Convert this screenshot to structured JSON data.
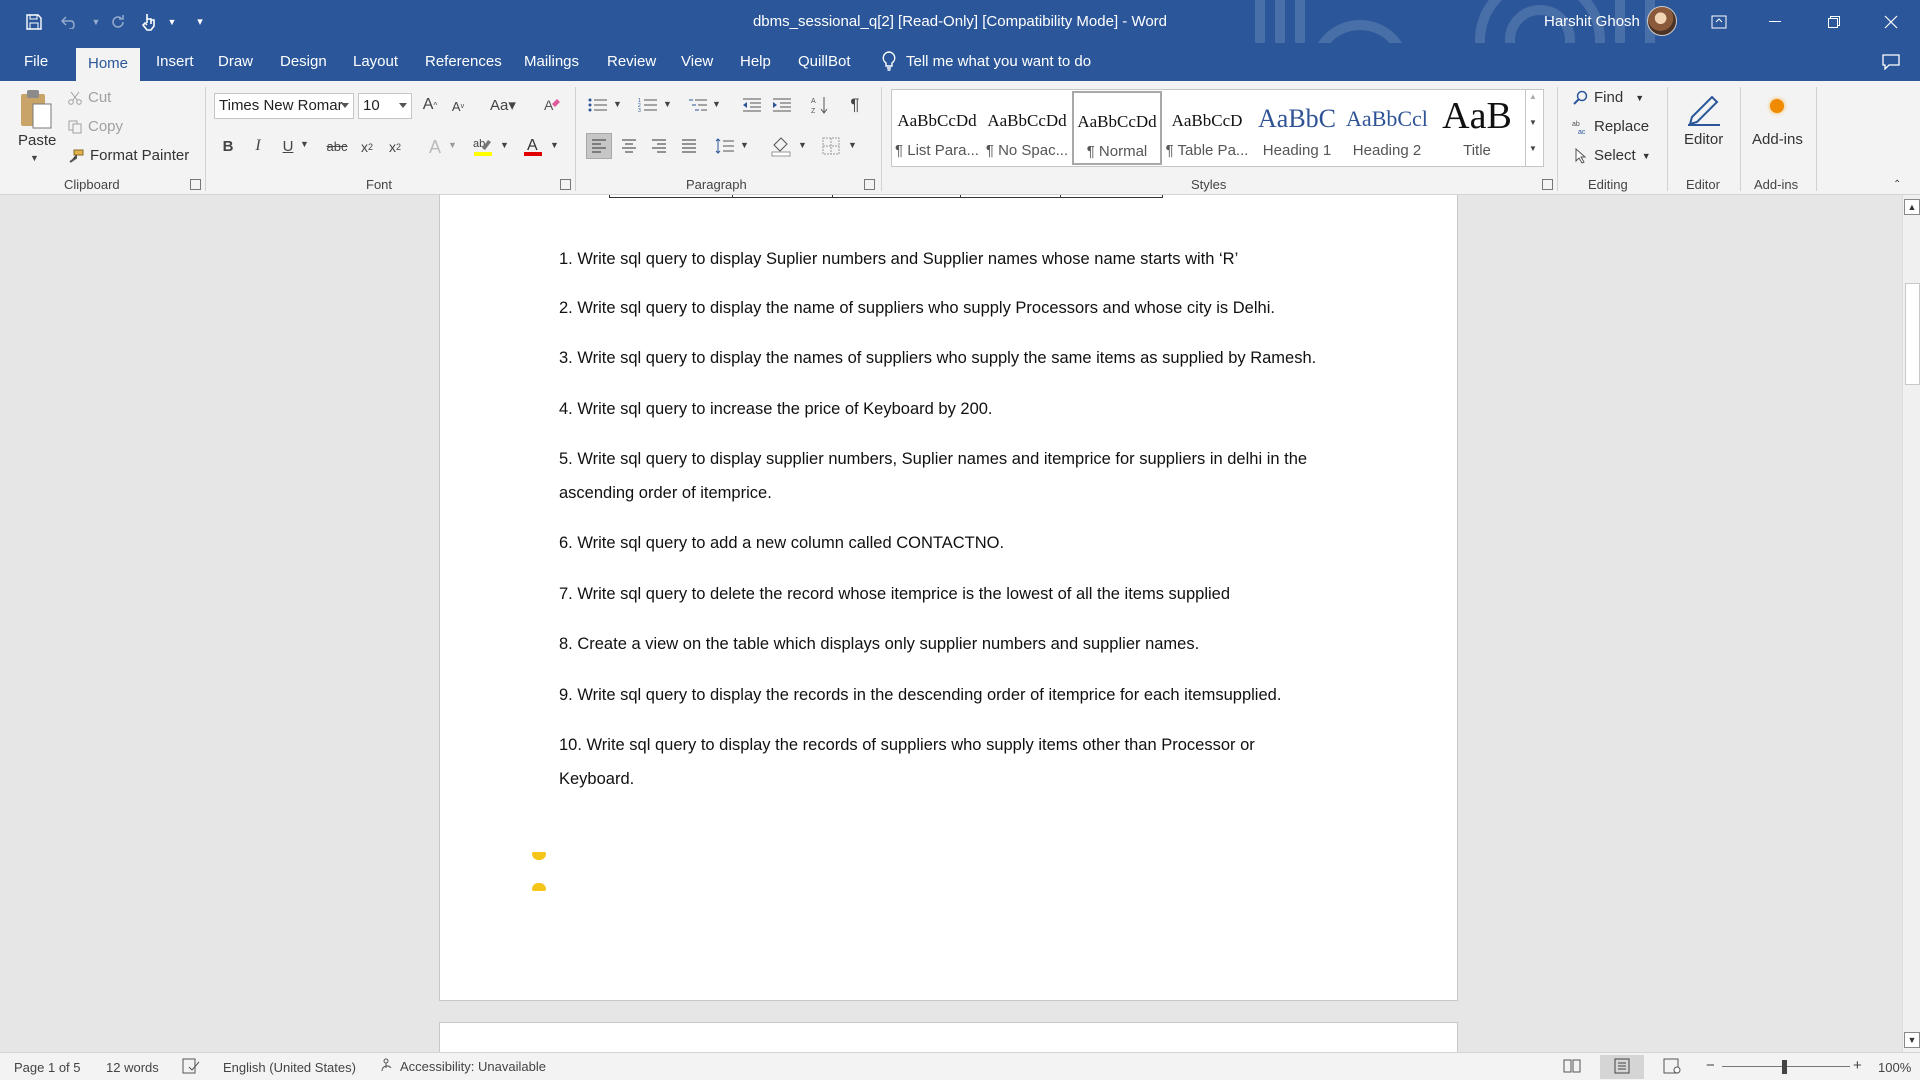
{
  "window": {
    "title": "dbms_sessional_q[2] [Read-Only] [Compatibility Mode]  -  Word",
    "user_name": "Harshit Ghosh",
    "accent": "#2b579a"
  },
  "quick_access": {
    "icons": [
      "save-icon",
      "undo-icon",
      "redo-icon",
      "touch-mode-icon",
      "customize-icon"
    ]
  },
  "tabs": [
    "File",
    "Home",
    "Insert",
    "Draw",
    "Design",
    "Layout",
    "References",
    "Mailings",
    "Review",
    "View",
    "Help",
    "QuillBot"
  ],
  "active_tab": "Home",
  "tell_me": "Tell me what you want to do",
  "ribbon": {
    "clipboard": {
      "paste": "Paste",
      "cut": "Cut",
      "copy": "Copy",
      "format_painter": "Format Painter",
      "label": "Clipboard"
    },
    "font": {
      "name": "Times New Romar",
      "size": "10",
      "label": "Font"
    },
    "paragraph": {
      "label": "Paragraph"
    },
    "styles": {
      "label": "Styles",
      "items": [
        {
          "preview": "AaBbCcDd",
          "name": "¶ List Para..."
        },
        {
          "preview": "AaBbCcDd",
          "name": "¶ No Spac..."
        },
        {
          "preview": "AaBbCcDd",
          "name": "¶ Normal"
        },
        {
          "preview": "AaBbCcD",
          "name": "¶ Table Pa..."
        },
        {
          "preview": "AaBbC",
          "name": "Heading 1"
        },
        {
          "preview": "AaBbCcl",
          "name": "Heading 2"
        },
        {
          "preview": "AaB",
          "name": "Title"
        }
      ],
      "selected": "¶ Normal"
    },
    "editing": {
      "find": "Find",
      "replace": "Replace",
      "select": "Select",
      "label": "Editing"
    },
    "editor": {
      "button": "Editor",
      "label": "Editor"
    },
    "addins": {
      "button": "Add-ins",
      "label": "Add-ins"
    }
  },
  "document": {
    "questions": [
      "1. Write sql query to display Suplier numbers and Supplier names whose name starts with ‘R’",
      "2. Write sql query to display the name of suppliers who supply Processors and whose city is Delhi.",
      "3. Write sql query to display the names of suppliers who supply the same items as supplied by Ramesh.",
      "4. Write sql query to increase the price of Keyboard by 200.",
      "5. Write sql query to display supplier numbers, Suplier names and itemprice for suppliers in delhi in the",
      "ascending order of itemprice.",
      "6. Write sql query to add a new column called CONTACTNO.",
      "7. Write sql query to delete the record whose itemprice is the lowest of all the items supplied",
      "8. Create a view on the table which displays only supplier numbers and supplier names.",
      "9. Write sql query to display the records in the descending order of itemprice for each itemsupplied.",
      "10.  Write sql query to display the records of suppliers who supply items other than Processor or",
      "Keyboard."
    ]
  },
  "status": {
    "page": "Page 1 of 5",
    "words": "12 words",
    "language": "English (United States)",
    "accessibility": "Accessibility: Unavailable",
    "zoom": "100%"
  }
}
